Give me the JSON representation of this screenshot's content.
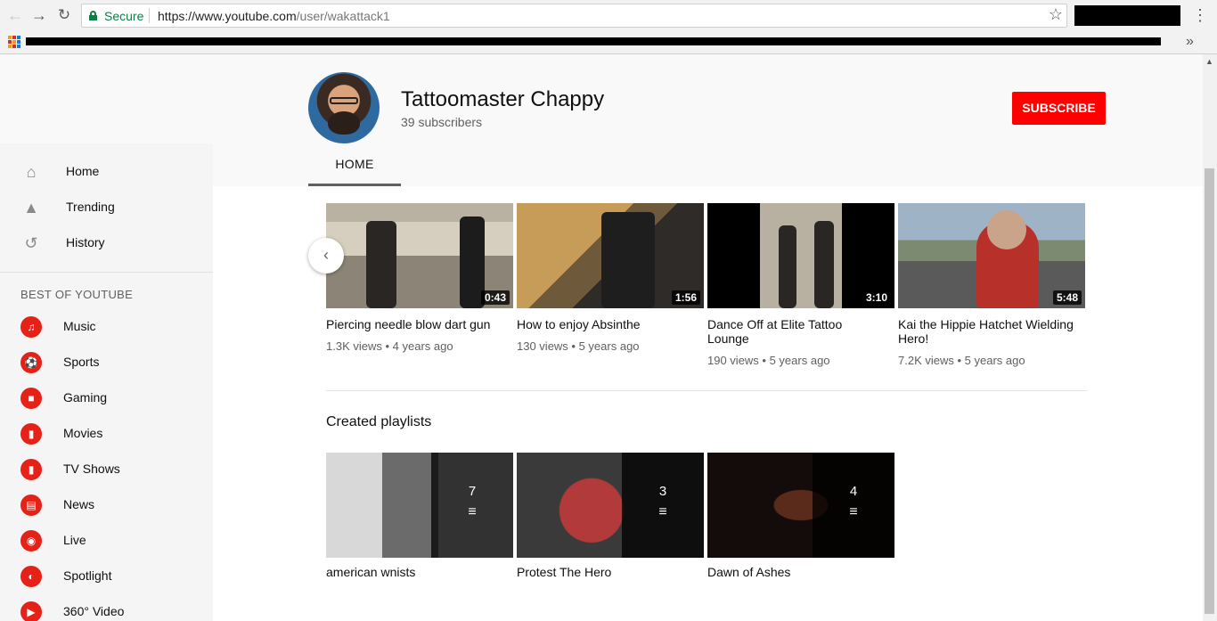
{
  "browser": {
    "secure_label": "Secure",
    "url_host": "https://www.youtube.com",
    "url_path": "/user/wakattack1"
  },
  "sidebar": {
    "items": [
      {
        "label": "Home",
        "icon": "home-icon"
      },
      {
        "label": "Trending",
        "icon": "flame-icon"
      },
      {
        "label": "History",
        "icon": "history-icon"
      }
    ],
    "heading": "BEST OF YOUTUBE",
    "categories": [
      {
        "label": "Music",
        "icon": "music-icon"
      },
      {
        "label": "Sports",
        "icon": "sports-icon"
      },
      {
        "label": "Gaming",
        "icon": "gaming-icon"
      },
      {
        "label": "Movies",
        "icon": "movies-icon"
      },
      {
        "label": "TV Shows",
        "icon": "tv-icon"
      },
      {
        "label": "News",
        "icon": "news-icon"
      },
      {
        "label": "Live",
        "icon": "live-icon"
      },
      {
        "label": "Spotlight",
        "icon": "spotlight-icon"
      },
      {
        "label": "360° Video",
        "icon": "360-icon"
      }
    ]
  },
  "channel": {
    "name": "Tattoomaster Chappy",
    "subscribers": "39 subscribers",
    "subscribe_label": "SUBSCRIBE",
    "tab_home": "HOME"
  },
  "videos": [
    {
      "title": "Piercing needle blow dart gun",
      "views": "1.3K views",
      "age": "4 years ago",
      "duration": "0:43"
    },
    {
      "title": "How to enjoy Absinthe",
      "views": "130 views",
      "age": "5 years ago",
      "duration": "1:56"
    },
    {
      "title": "Dance Off at Elite Tattoo Lounge",
      "views": "190 views",
      "age": "5 years ago",
      "duration": "3:10"
    },
    {
      "title": "Kai the Hippie Hatchet Wielding Hero!",
      "views": "7.2K views",
      "age": "5 years ago",
      "duration": "5:48"
    }
  ],
  "playlists_section": {
    "title": "Created playlists",
    "items": [
      {
        "title": "american wnists",
        "count": "7"
      },
      {
        "title": "Protest The Hero",
        "count": "3"
      },
      {
        "title": "Dawn of Ashes",
        "count": "4"
      }
    ]
  },
  "colors": {
    "accent": "#ff0000",
    "secure": "#0b8043"
  }
}
